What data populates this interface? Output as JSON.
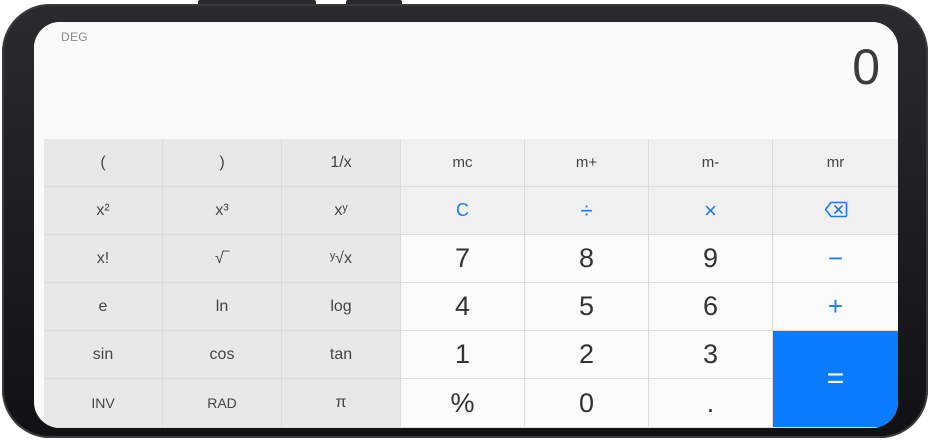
{
  "display": {
    "mode": "DEG",
    "value": "0"
  },
  "keys": {
    "row1": [
      "(",
      ")",
      "1/x",
      "mc",
      "m+",
      "m-",
      "mr"
    ],
    "row2": [
      "x²",
      "x³",
      "xʸ",
      "C",
      "÷",
      "×"
    ],
    "row3": [
      "x!",
      "√‾",
      "ʸ√x",
      "7",
      "8",
      "9",
      "−"
    ],
    "row4": [
      "e",
      "ln",
      "log",
      "4",
      "5",
      "6",
      "+"
    ],
    "row5": [
      "sin",
      "cos",
      "tan",
      "1",
      "2",
      "3",
      "="
    ],
    "row6": [
      "INV",
      "RAD",
      "π",
      "%",
      "0",
      "."
    ]
  },
  "colors": {
    "accent": "#0a7cff",
    "accent_text": "#1e7cf0",
    "sci_bg": "#e8e8e8",
    "num_bg": "#fbfbfb"
  },
  "icons": {
    "backspace": "backspace-icon"
  }
}
